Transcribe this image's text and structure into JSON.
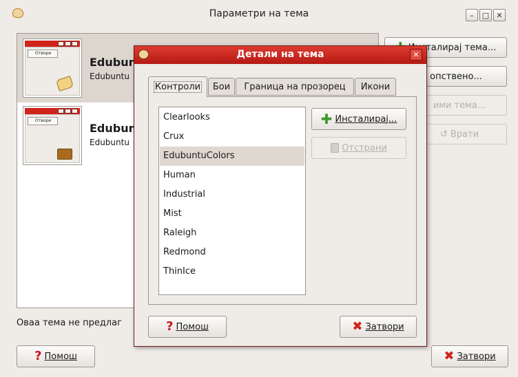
{
  "main_window": {
    "title": "Параметри на тема",
    "themes": [
      {
        "name": "Edubun",
        "description": "Edubuntu",
        "thumb_button": "Отвори"
      },
      {
        "name": "Edubun",
        "description": "Edubuntu",
        "thumb_button": "Отвори"
      }
    ],
    "right_buttons": {
      "install": "Инсталирај тема...",
      "custom": "опствено...",
      "save": "ими тема...",
      "revert": "Врати"
    },
    "footer_text": "Оваа тема не предлаг",
    "help_label": "Помош",
    "close_label": "Затвори"
  },
  "dialog": {
    "title": "Детали на тема",
    "tabs": [
      "Контроли",
      "Бои",
      "Граница на прозорец",
      "Икони"
    ],
    "active_tab": "Контроли",
    "theme_list": [
      "Clearlooks",
      "Crux",
      "EdubuntuColors",
      "Human",
      "Industrial",
      "Mist",
      "Raleigh",
      "Redmond",
      "ThinIce"
    ],
    "selected": "EdubuntuColors",
    "install_label": "Инсталирај...",
    "remove_label": "Отстрани",
    "help_label": "Помош",
    "close_label": "Затвори"
  },
  "colors": {
    "accent": "#d0231c",
    "selection": "#dfd8d0",
    "window_bg": "#efebe7"
  }
}
